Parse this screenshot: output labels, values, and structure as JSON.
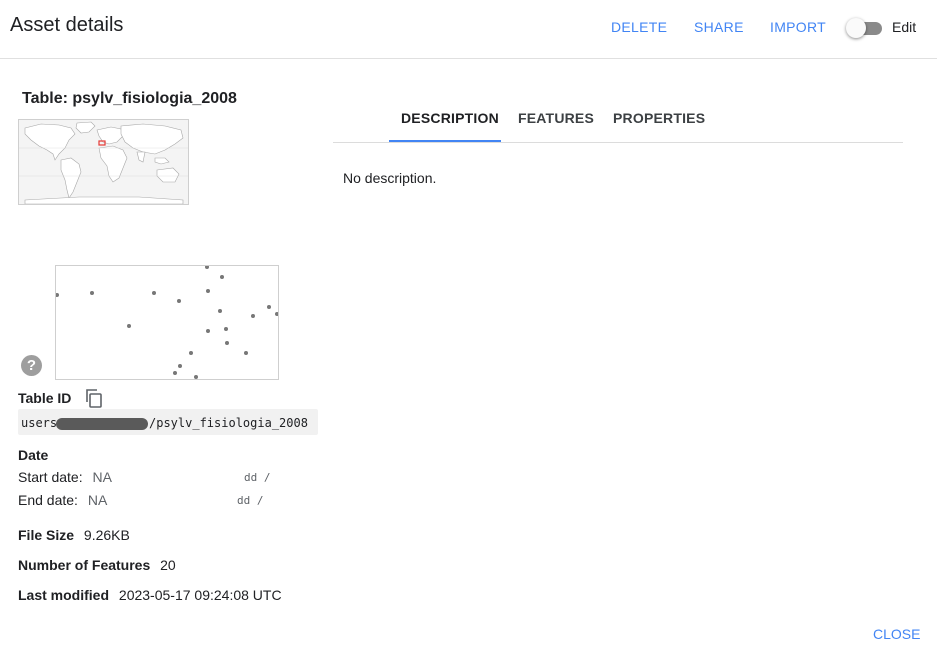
{
  "header": {
    "title": "Asset details",
    "delete_label": "DELETE",
    "share_label": "SHARE",
    "import_label": "IMPORT",
    "edit_label": "Edit",
    "edit_enabled": false
  },
  "asset": {
    "title": "Table: psylv_fisiologia_2008",
    "table_id_label": "Table ID",
    "table_id_prefix": "users",
    "table_id_suffix": "/psylv_fisiologia_2008",
    "date_label": "Date",
    "start_date_label": "Start date:",
    "start_date_value": "NA",
    "start_date_format": "dd /",
    "end_date_label": "End date:",
    "end_date_value": "NA",
    "end_date_format": "dd /",
    "file_size_label": "File Size",
    "file_size_value": "9.26KB",
    "features_label": "Number of Features",
    "features_value": "20",
    "modified_label": "Last modified",
    "modified_value": "2023-05-17 09:24:08 UTC"
  },
  "tabs": [
    {
      "label": "DESCRIPTION",
      "active": true
    },
    {
      "label": "FEATURES",
      "active": false
    },
    {
      "label": "PROPERTIES",
      "active": false
    }
  ],
  "description_text": "No description.",
  "footer": {
    "close_label": "CLOSE"
  },
  "icons": {
    "help": "help-circle-icon",
    "copy": "copy-icon"
  },
  "colors": {
    "accent": "#4285f4",
    "toggle_track": "#8a8a8a",
    "point": "#777777"
  }
}
